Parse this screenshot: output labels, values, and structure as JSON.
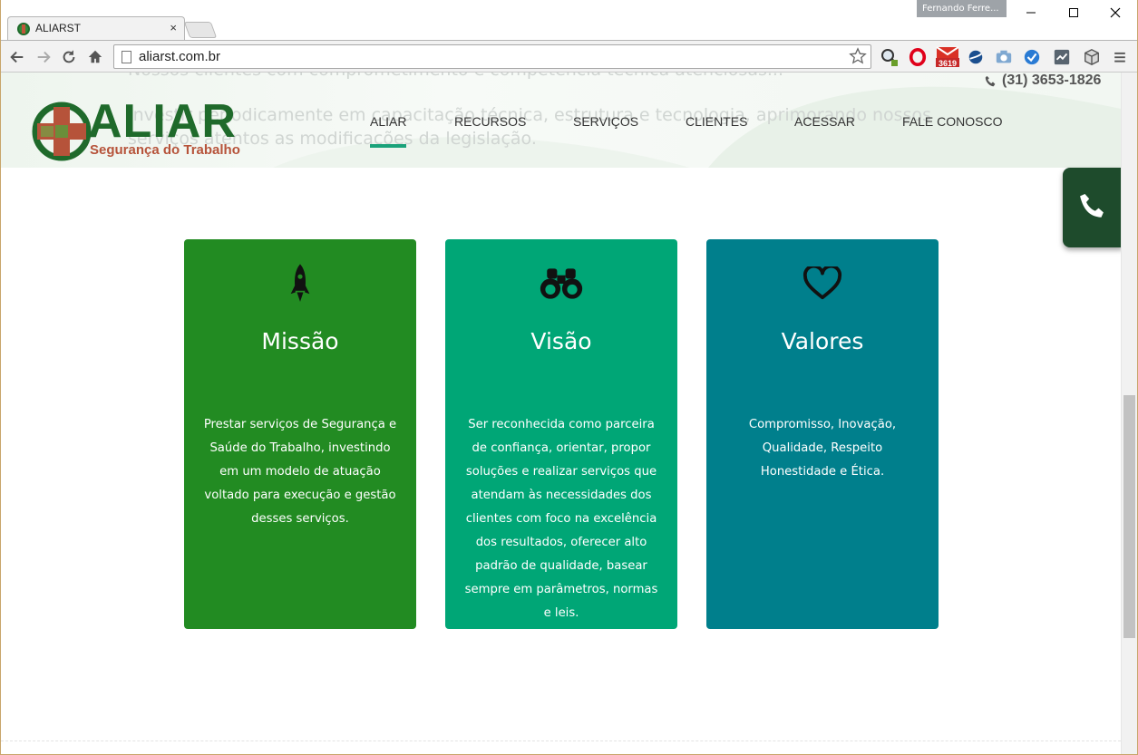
{
  "browser": {
    "tab_title": "ALIARST",
    "tab_close": "×",
    "profile_name": "Fernando Ferre...",
    "url": "aliarst.com.br",
    "extension_badge": "3619"
  },
  "site": {
    "phone": "(31) 3653-1826",
    "logo_word": "ALIAR",
    "logo_sub": "Segurança do Trabalho",
    "ghost_lines": [
      "Investir periodicamente em capacitação técnica, estrutura e tecnologia, aprimorando nossos",
      "serviços atentos as modificações da legislação."
    ],
    "nav": [
      "ALIAR",
      "RECURSOS",
      "SERVIÇOS",
      "CLIENTES",
      "ACESSAR",
      "FALE CONOSCO"
    ],
    "active_nav": "ALIAR"
  },
  "cards": [
    {
      "title": "Missão",
      "icon": "rocket-icon",
      "color": "#228b22",
      "text": "Prestar serviços de Segurança e Saúde do Trabalho, investindo em um modelo de atuação voltado para execução e gestão desses serviços."
    },
    {
      "title": "Visão",
      "icon": "binoculars-icon",
      "color": "#00a676",
      "text": "Ser reconhecida como parceira de confiança, orientar, propor soluções e realizar serviços que atendam às necessidades dos clientes com foco na excelência dos resultados, oferecer alto padrão de qualidade, basear sempre em parâmetros, normas e leis."
    },
    {
      "title": "Valores",
      "icon": "heart-icon",
      "color": "#007f8c",
      "text": "Compromisso, Inovação, Qualidade, Respeito Honestidade e Ética."
    }
  ],
  "colors": {
    "brand_green": "#1f6a2b",
    "brand_orange": "#b6533a",
    "nav_underline": "#1aa27a",
    "call_button": "#1e4b2c"
  }
}
